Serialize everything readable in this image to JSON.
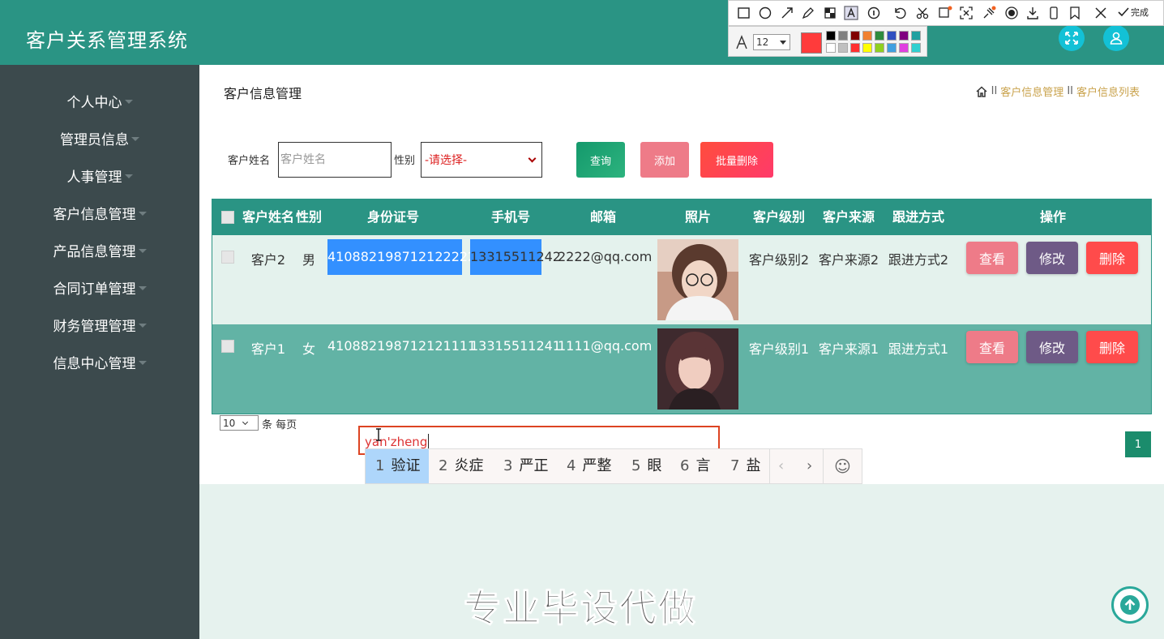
{
  "header": {
    "title": "客户关系管理系统"
  },
  "sidebar": {
    "items": [
      {
        "label": "个人中心"
      },
      {
        "label": "管理员信息"
      },
      {
        "label": "人事管理"
      },
      {
        "label": "客户信息管理"
      },
      {
        "label": "产品信息管理"
      },
      {
        "label": "合同订单管理"
      },
      {
        "label": "财务管理管理"
      },
      {
        "label": "信息中心管理"
      }
    ]
  },
  "page": {
    "title": "客户信息管理",
    "breadcrumb": [
      "客户信息管理",
      "客户信息列表"
    ],
    "breadcrumb_sep": "II"
  },
  "search": {
    "name_label": "客户姓名",
    "name_placeholder": "客户姓名",
    "gender_label": "性别",
    "gender_value": "-请选择-",
    "query_button": "查询",
    "add_button": "添加",
    "batch_delete_button": "批量删除"
  },
  "table": {
    "columns": [
      "客户姓名",
      "性别",
      "身份证号",
      "手机号",
      "邮箱",
      "照片",
      "客户级别",
      "客户来源",
      "跟进方式",
      "操作"
    ],
    "rows": [
      {
        "name": "客户2",
        "gender": "男",
        "id_card": "410882198712122222",
        "phone": "13315511242",
        "email": "2222@qq.com",
        "level": "客户级别2",
        "source": "客户来源2",
        "follow": "跟进方式2"
      },
      {
        "name": "客户1",
        "gender": "女",
        "id_card": "410882198712121111",
        "phone": "13315511241",
        "email": "1111@qq.com",
        "level": "客户级别1",
        "source": "客户来源1",
        "follow": "跟进方式1"
      }
    ],
    "actions": {
      "view": "查看",
      "edit": "修改",
      "delete": "删除"
    }
  },
  "pagination": {
    "page_size": "10",
    "page_size_label": "条 每页",
    "current_page": "1"
  },
  "ime": {
    "composition": "yan'zheng",
    "candidates": [
      {
        "num": "1",
        "text": "验证"
      },
      {
        "num": "2",
        "text": "炎症"
      },
      {
        "num": "3",
        "text": "严正"
      },
      {
        "num": "4",
        "text": "严整"
      },
      {
        "num": "5",
        "text": "眼"
      },
      {
        "num": "6",
        "text": "言"
      },
      {
        "num": "7",
        "text": "盐"
      }
    ]
  },
  "watermark": "专业毕设代做",
  "snip_toolbar": {
    "done_label": "完成",
    "font_size": "12",
    "current_color": "#ff3b3b",
    "palette": [
      "#000000",
      "#808080",
      "#800000",
      "#f08030",
      "#2e8b3e",
      "#3050c0",
      "#800080",
      "#20a0a0",
      "#ffffff",
      "#c0c0c0",
      "#ff3030",
      "#ffff00",
      "#90d020",
      "#40a0e0",
      "#e040e0",
      "#30d0d0"
    ]
  },
  "colors": {
    "primary": "#2a9484",
    "sidebar": "#3c4a4d",
    "row_alt": "#62b3a5"
  }
}
